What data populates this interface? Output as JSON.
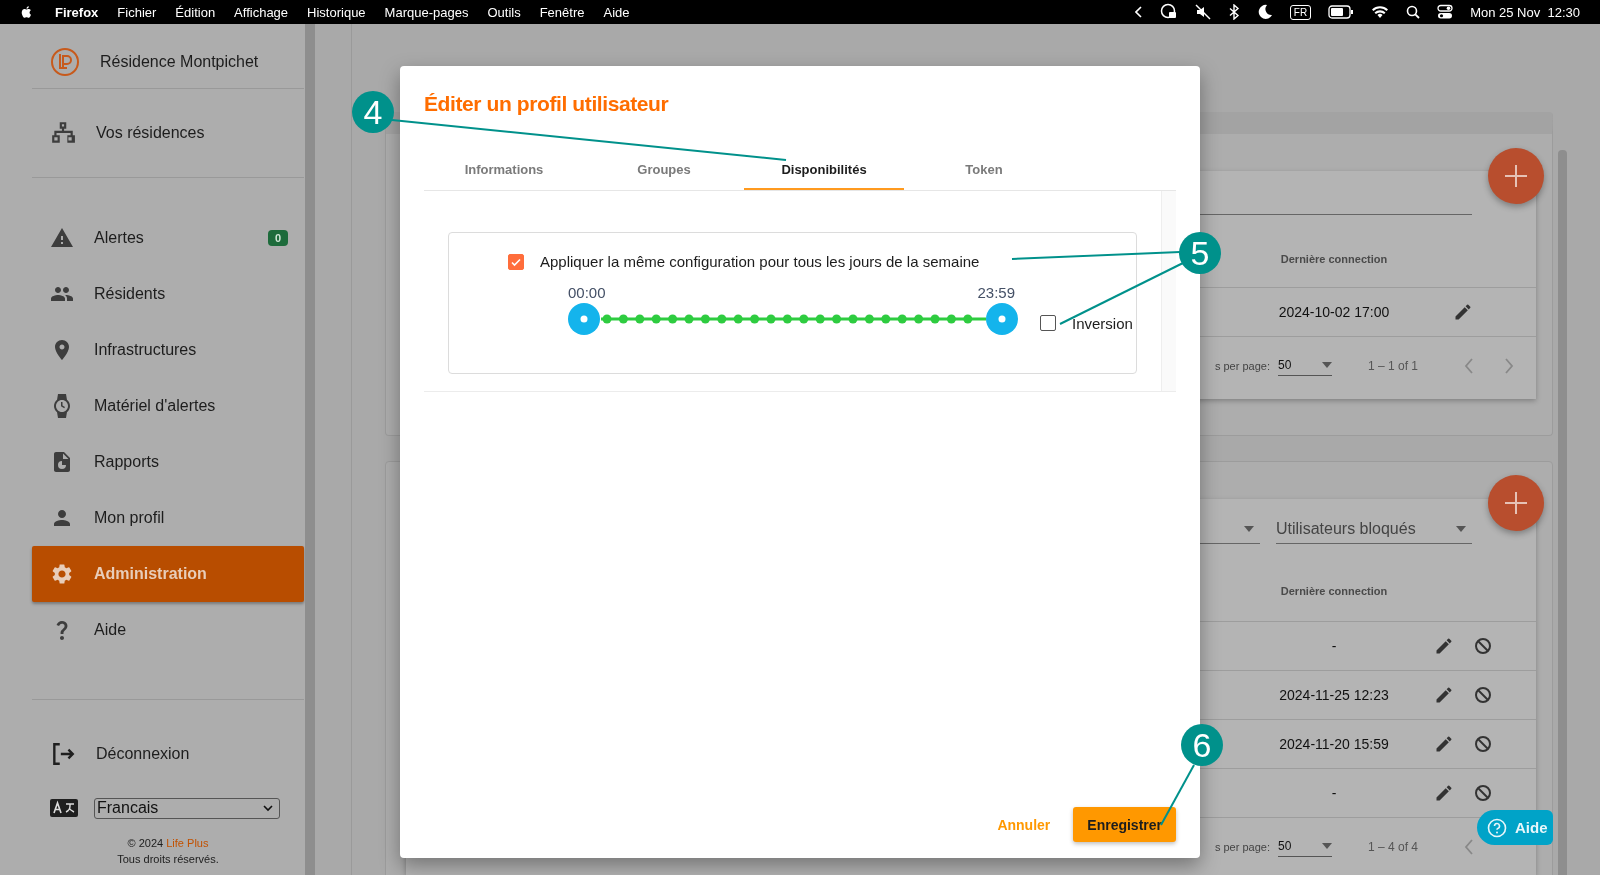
{
  "menubar": {
    "app": "Firefox",
    "menus": [
      "Fichier",
      "Édition",
      "Affichage",
      "Historique",
      "Marque-pages",
      "Outils",
      "Fenêtre",
      "Aide"
    ],
    "input_source": "FR",
    "clock": "Mon 25 Nov  12:30"
  },
  "sidebar": {
    "residence": "Résidence Montpichet",
    "residences_link": "Vos résidences",
    "items": [
      {
        "label": "Alertes",
        "badge": "0",
        "selected": false
      },
      {
        "label": "Résidents",
        "selected": false
      },
      {
        "label": "Infrastructures",
        "selected": false
      },
      {
        "label": "Matériel d'alertes",
        "selected": false
      },
      {
        "label": "Rapports",
        "selected": false
      },
      {
        "label": "Mon profil",
        "selected": false
      },
      {
        "label": "Administration",
        "selected": true
      },
      {
        "label": "Aide",
        "selected": false
      }
    ],
    "logout": "Déconnexion",
    "language": "Francais",
    "copyright": "© 2024 ",
    "brand": "Life Plus",
    "rights": "Tous droits réservés."
  },
  "cards": [
    {
      "header": "Dernière connection",
      "blockable": false,
      "rows": [
        "2024-10-02 17:00"
      ],
      "per_page_label": "s per page:",
      "per_page": "50",
      "range": "1 – 1 of 1"
    },
    {
      "filter": "Utilisateurs bloqués",
      "header": "Dernière connection",
      "blockable": true,
      "rows": [
        "-",
        "2024-11-25 12:23",
        "2024-11-20 15:59",
        "-"
      ],
      "per_page_label": "s per page:",
      "per_page": "50",
      "range": "1 – 4 of 4"
    }
  ],
  "help_button": "Aide",
  "dialog": {
    "title": "Éditer un profil utilisateur",
    "tabs": [
      {
        "label": "Informations",
        "selected": false
      },
      {
        "label": "Groupes",
        "selected": false
      },
      {
        "label": "Disponibilités",
        "selected": true
      },
      {
        "label": "Token",
        "selected": false
      }
    ],
    "apply_all": {
      "label": "Appliquer la même configuration pour tous les jours de la semaine",
      "checked": true
    },
    "slider": {
      "start_label": "00:00",
      "end_label": "23:59",
      "level": 1
    },
    "inversion": {
      "label": "Inversion",
      "checked": false
    },
    "cancel": "Annuler",
    "save": "Enregistrer"
  },
  "callouts": [
    "4",
    "5",
    "6"
  ]
}
